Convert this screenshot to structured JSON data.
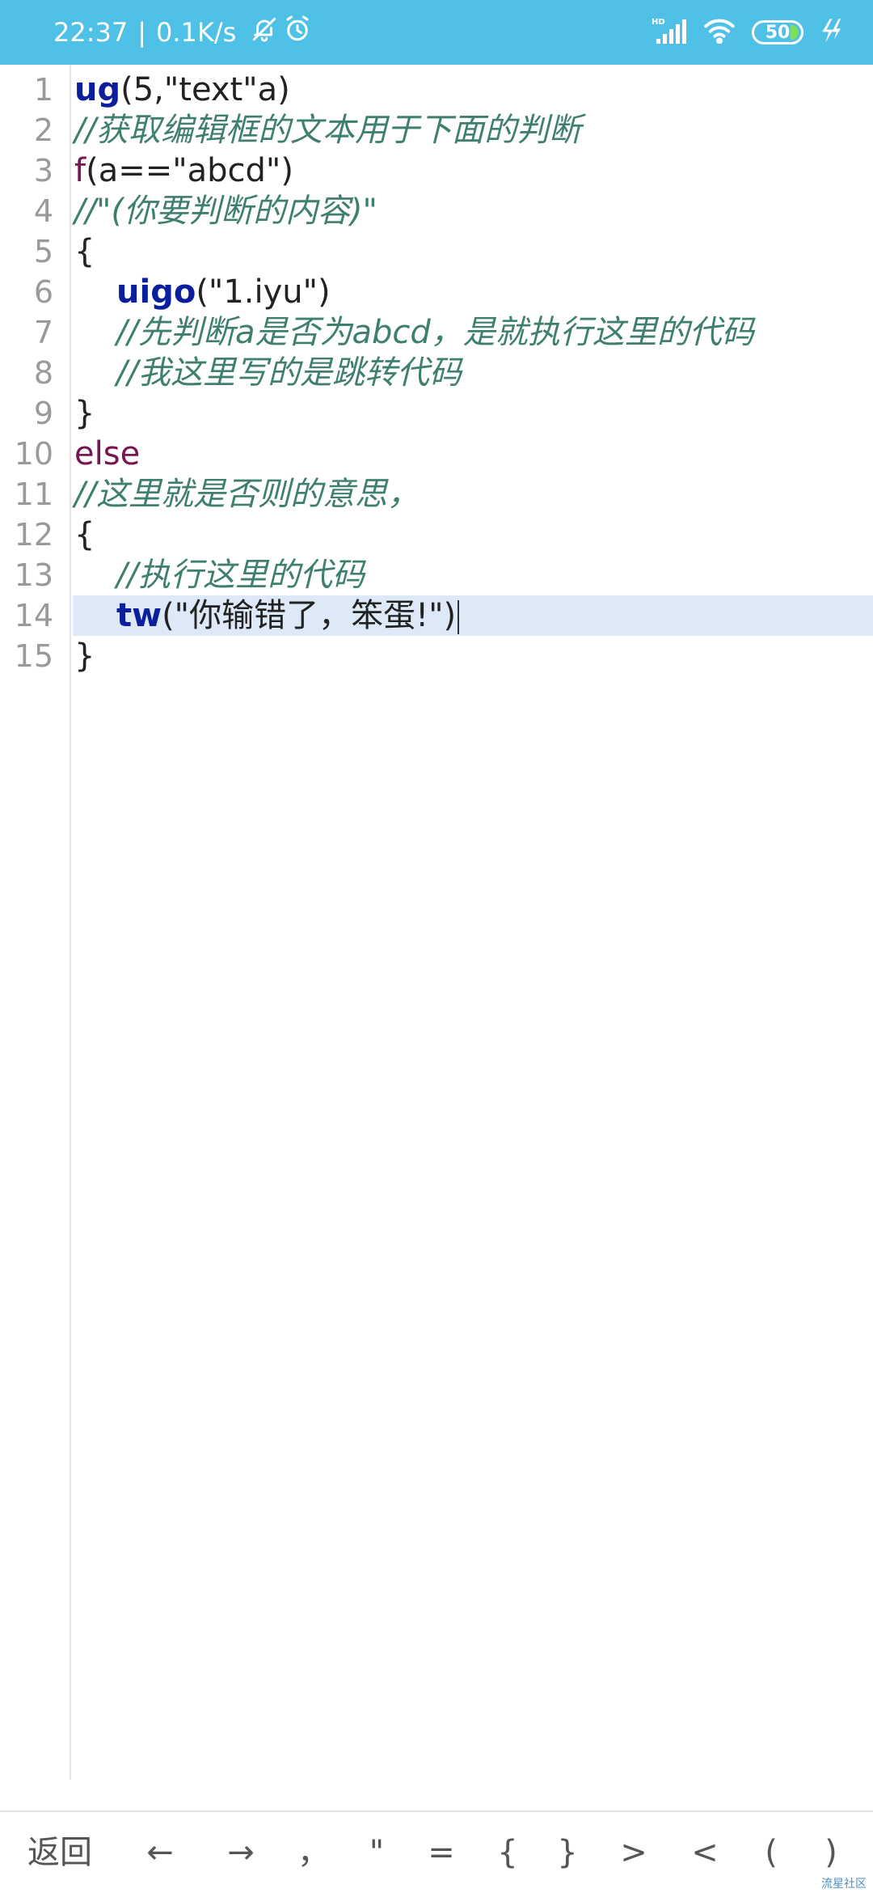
{
  "status_bar": {
    "time": "22:37",
    "separator": "|",
    "net_speed": "0.1K/s",
    "icons": [
      "bell-off-icon",
      "alarm-icon",
      "hd-signal-icon",
      "wifi-icon",
      "battery-icon",
      "charging-icon"
    ],
    "signal_label": "HD",
    "battery_level": "50",
    "background_color": "#4fc1e6"
  },
  "editor": {
    "lines": [
      {
        "num": "1"
      },
      {
        "num": "2",
        "text": "//获取编辑框的文本用于下面的判断"
      },
      {
        "num": "3",
        "kw": "f",
        "rest": "(a==\"abcd\")"
      },
      {
        "num": "4",
        "text": "//\"(你要判断的内容)\""
      },
      {
        "num": "5",
        "text": "{"
      },
      {
        "num": "6",
        "fn": "uigo",
        "rest": "(\"1.iyu\")"
      },
      {
        "num": "7",
        "text": "//先判断a是否为abcd，是就执行这里的代码"
      },
      {
        "num": "8",
        "text": "//我这里写的是跳转代码"
      },
      {
        "num": "9",
        "text": "}"
      },
      {
        "num": "10",
        "text": "else"
      },
      {
        "num": "11",
        "text": "//这里就是否则的意思，"
      },
      {
        "num": "12",
        "text": "{"
      },
      {
        "num": "13",
        "text": "//执行这里的代码"
      },
      {
        "num": "14",
        "fn": "tw",
        "rest": "(\"你输错了，笨蛋!\")"
      },
      {
        "num": "15",
        "text": "}"
      }
    ],
    "line1": {
      "fn": "ug",
      "rest": "(5,\"text\"a)"
    },
    "current_line": "14",
    "colors": {
      "function": "#0b1f9e",
      "keyword": "#7a1451",
      "comment": "#3f7f6f",
      "line_number": "#9a9a9a",
      "current_line_bg": "#dde9f6"
    }
  },
  "toolbar": {
    "keys": [
      "返回",
      "←",
      "→",
      "，",
      "\"",
      "=",
      "{",
      "}",
      ">",
      "<",
      "(",
      ")"
    ]
  },
  "watermark": "流星社区"
}
